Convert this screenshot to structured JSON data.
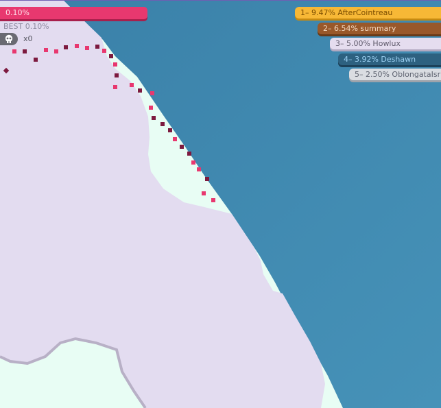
{
  "hud": {
    "progress_text": "0.10%",
    "progress_value": 0.001,
    "best_text": "BEST 0.10%",
    "kills_text": "x0",
    "player_color": "#e8386f"
  },
  "leaderboard": [
    {
      "text": "1– 9.47% AfterCointreau",
      "bg": "#f7b836",
      "shadow": "#c68a10",
      "fg": "#7a4c00"
    },
    {
      "text": "2– 6.54% summary",
      "bg": "#99582a",
      "shadow": "#6a3a17",
      "fg": "#f4d9c0"
    },
    {
      "text": "3– 5.00% Howlux",
      "bg": "#e5ddef",
      "shadow": "#b2a9c1",
      "fg": "#5f5a6b"
    },
    {
      "text": "4– 3.92% Deshawn",
      "bg": "#2d6180",
      "shadow": "#1c4159",
      "fg": "#9fd3f5"
    },
    {
      "text": "5– 2.50% OblongataIsr",
      "bg": "#dadde2",
      "shadow": "#9ea3ab",
      "fg": "#5e6370"
    }
  ],
  "colors": {
    "water": "#3f88b0",
    "territory": "#e3dcf0",
    "shore": "#e8fdf4",
    "trail_light": "#e8386f",
    "trail_dark": "#7d1a3f"
  }
}
